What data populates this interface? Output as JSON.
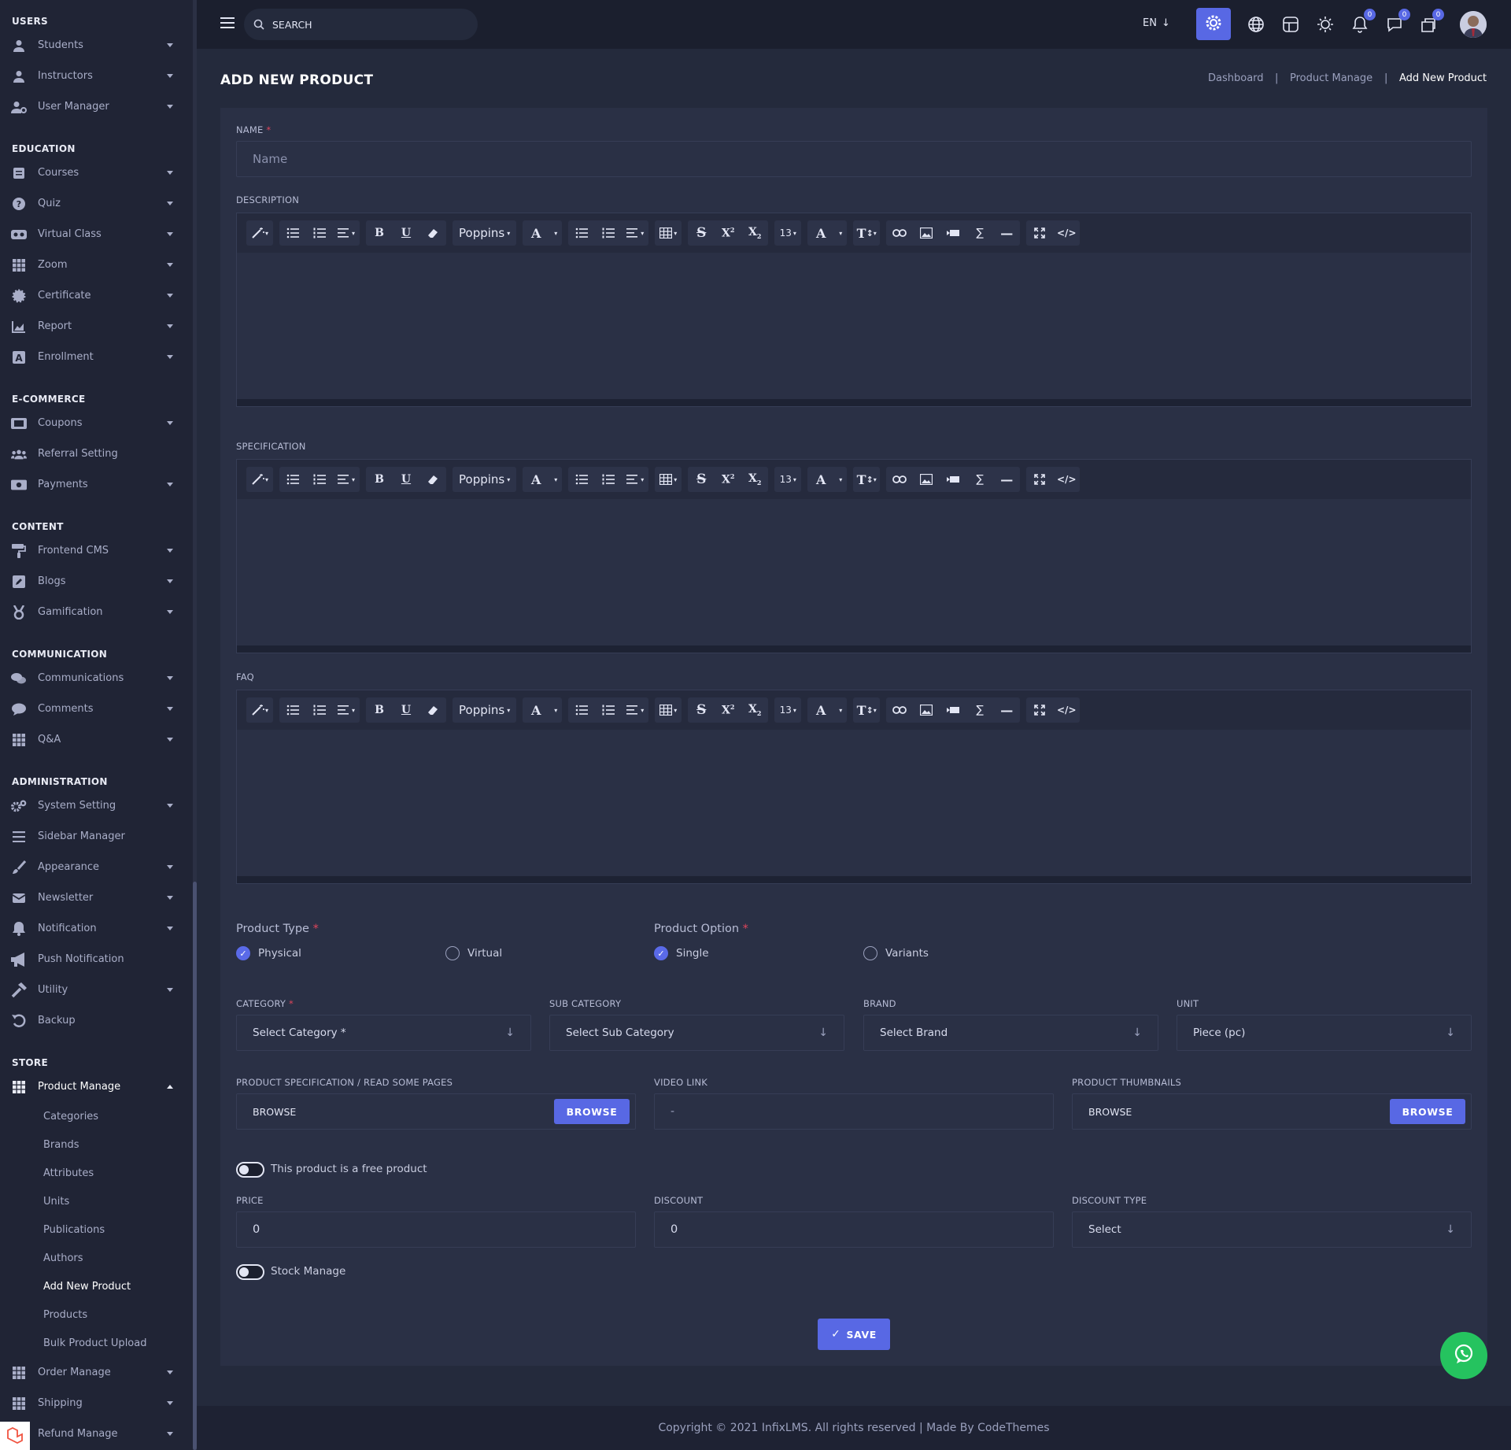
{
  "sidebar": {
    "sections": [
      "USERS",
      "EDUCATION",
      "E-COMMERCE",
      "CONTENT",
      "COMMUNICATION",
      "ADMINISTRATION",
      "STORE"
    ],
    "items": {
      "students": "Students",
      "instructors": "Instructors",
      "user_manager": "User Manager",
      "courses": "Courses",
      "quiz": "Quiz",
      "virtual_class": "Virtual Class",
      "zoom": "Zoom",
      "certificate": "Certificate",
      "report": "Report",
      "enrollment": "Enrollment",
      "coupons": "Coupons",
      "referral_setting": "Referral Setting",
      "payments": "Payments",
      "frontend_cms": "Frontend CMS",
      "blogs": "Blogs",
      "gamification": "Gamification",
      "communications": "Communications",
      "comments": "Comments",
      "qa": "Q&A",
      "system_setting": "System Setting",
      "sidebar_manager": "Sidebar Manager",
      "appearance": "Appearance",
      "newsletter": "Newsletter",
      "notification": "Notification",
      "push_notification": "Push Notification",
      "utility": "Utility",
      "backup": "Backup",
      "product_manage": "Product Manage",
      "order_manage": "Order Manage",
      "shipping": "Shipping",
      "refund_manage": "Refund Manage"
    },
    "product_submenu": [
      "Categories",
      "Brands",
      "Attributes",
      "Units",
      "Publications",
      "Authors",
      "Add New Product",
      "Products",
      "Bulk Product Upload"
    ]
  },
  "topbar": {
    "search_placeholder": "SEARCH",
    "language": "EN",
    "badge_counts": [
      "0",
      "0",
      "0"
    ]
  },
  "page": {
    "title": "ADD NEW PRODUCT",
    "breadcrumb": [
      "Dashboard",
      "Product Manage",
      "Add New Product"
    ]
  },
  "form": {
    "name_label": "NAME",
    "name_placeholder": "Name",
    "description_label": "DESCRIPTION",
    "specification_label": "SPECIFICATION",
    "faq_label": "FAQ",
    "toolbar": {
      "font": "Poppins",
      "size": "13"
    },
    "product_type_label": "Product Type",
    "product_type_options": [
      "Physical",
      "Virtual"
    ],
    "product_option_label": "Product Option",
    "product_option_options": [
      "Single",
      "Variants"
    ],
    "category_label": "CATEGORY",
    "category_value": "Select Category *",
    "sub_category_label": "SUB CATEGORY",
    "sub_category_value": "Select Sub Category",
    "brand_label": "BRAND",
    "brand_value": "Select Brand",
    "unit_label": "UNIT",
    "unit_value": "Piece (pc)",
    "spec_file_label": "PRODUCT SPECIFICATION / READ SOME PAGES",
    "browse_text": "BROWSE",
    "browse_button": "BROWSE",
    "video_label": "VIDEO LINK",
    "video_value": "-",
    "thumb_label": "PRODUCT THUMBNAILS",
    "free_toggle_label": "This product is a free product",
    "price_label": "PRICE",
    "price_value": "0",
    "discount_label": "DISCOUNT",
    "discount_value": "0",
    "discount_type_label": "DISCOUNT TYPE",
    "discount_type_value": "Select",
    "stock_toggle_label": "Stock Manage",
    "save_button": "SAVE"
  },
  "footer": {
    "text": "Copyright © 2021 InfixLMS. All rights reserved | Made By CodeThemes"
  },
  "colors": {
    "accent": "#5868e4",
    "whatsapp": "#25c35f",
    "required": "#e0455b"
  }
}
